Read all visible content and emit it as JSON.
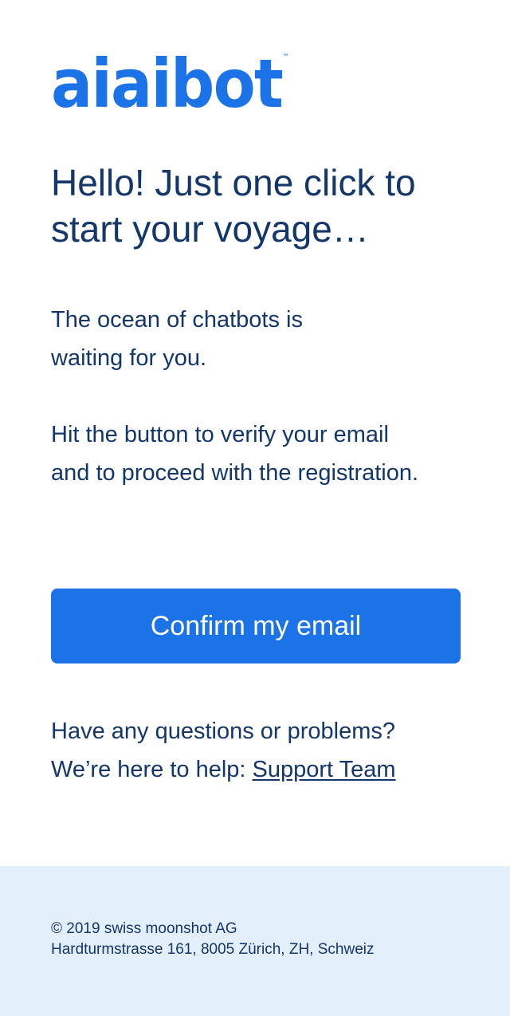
{
  "brand": {
    "logo_text": "aiaibot",
    "trademark": "™",
    "color": "#1c73e8"
  },
  "headline": "Hello! Just one click to start your voyage…",
  "body": {
    "paragraph_1_line_1": "The ocean of chatbots is",
    "paragraph_1_line_2": "waiting for you.",
    "paragraph_2_line_1": "Hit the button to verify your email",
    "paragraph_2_line_2": "and to proceed with the registration."
  },
  "cta": {
    "label": "Confirm my email",
    "color": "#1c73e8"
  },
  "help": {
    "line_1": "Have any questions or problems?",
    "line_2_prefix": "We’re here to help: ",
    "link_label": "Support Team"
  },
  "footer": {
    "copyright": "© 2019 swiss moonshot AG",
    "address": "Hardturmstrasse 161, 8005 Zürich, ZH, Schweiz",
    "background": "#e4effc"
  },
  "colors": {
    "text": "#13366b"
  }
}
